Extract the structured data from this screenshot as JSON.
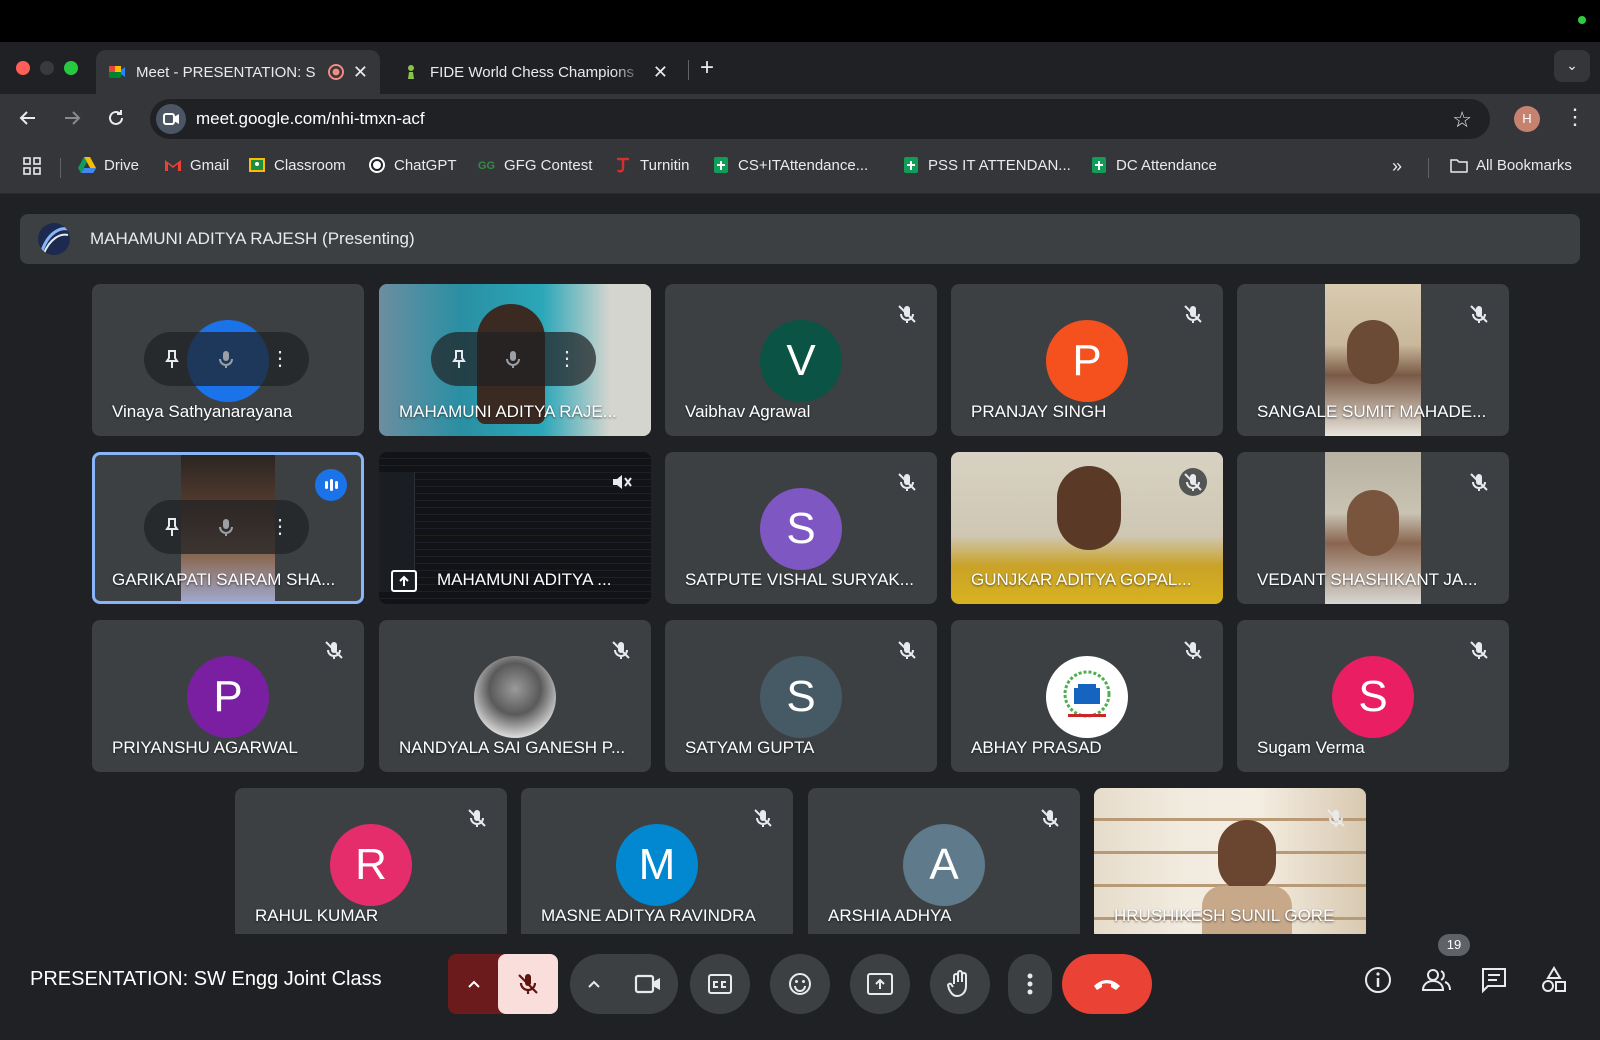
{
  "browser": {
    "tabs": [
      {
        "title": "Meet - PRESENTATION: S",
        "active": true
      },
      {
        "title": "FIDE World Chess Champions",
        "active": false
      }
    ],
    "url": "meet.google.com/nhi-tmxn-acf",
    "profile_initial": "H",
    "bookmarks": [
      {
        "label": "Drive",
        "icon": "drive-icon"
      },
      {
        "label": "Gmail",
        "icon": "gmail-icon"
      },
      {
        "label": "Classroom",
        "icon": "classroom-icon"
      },
      {
        "label": "ChatGPT",
        "icon": "chatgpt-icon"
      },
      {
        "label": "GFG Contest",
        "icon": "gfg-icon"
      },
      {
        "label": "Turnitin",
        "icon": "turnitin-icon"
      },
      {
        "label": "CS+ITAttendance...",
        "icon": "sheets-icon"
      },
      {
        "label": "PSS IT ATTENDAN...",
        "icon": "sheets-icon"
      },
      {
        "label": "DC Attendance",
        "icon": "sheets-icon"
      }
    ],
    "all_bookmarks": "All Bookmarks"
  },
  "meet": {
    "presenting_banner": "MAHAMUNI ADITYA RAJESH (Presenting)",
    "meeting_name": "PRESENTATION: SW Engg Joint Class",
    "participant_count": "19",
    "participants": [
      {
        "name": "Vinaya Sathyanarayana",
        "type": "avatar",
        "initial": "",
        "color": "#1a73e8"
      },
      {
        "name": "MAHAMUNI ADITYA RAJE...",
        "type": "video"
      },
      {
        "name": "Vaibhav Agrawal",
        "type": "avatar",
        "initial": "V",
        "color": "#0b5345"
      },
      {
        "name": "PRANJAY SINGH",
        "type": "avatar",
        "initial": "P",
        "color": "#f4511e"
      },
      {
        "name": "SANGALE SUMIT MAHADE...",
        "type": "video"
      },
      {
        "name": "GARIKAPATI SAIRAM SHA...",
        "type": "video"
      },
      {
        "name": "MAHAMUNI ADITYA ...",
        "type": "screen"
      },
      {
        "name": "SATPUTE VISHAL SURYAK...",
        "type": "avatar",
        "initial": "S",
        "color": "#7e57c2"
      },
      {
        "name": "GUNJKAR ADITYA GOPAL...",
        "type": "video"
      },
      {
        "name": "VEDANT SHASHIKANT JA...",
        "type": "video"
      },
      {
        "name": "PRIYANSHU AGARWAL",
        "type": "avatar",
        "initial": "P",
        "color": "#7b1fa2"
      },
      {
        "name": "NANDYALA SAI GANESH P...",
        "type": "photo"
      },
      {
        "name": "SATYAM GUPTA",
        "type": "avatar",
        "initial": "S",
        "color": "#455a64"
      },
      {
        "name": "ABHAY PRASAD",
        "type": "logo"
      },
      {
        "name": "Sugam Verma",
        "type": "avatar",
        "initial": "S",
        "color": "#e91e63"
      },
      {
        "name": "RAHUL KUMAR",
        "type": "avatar",
        "initial": "R",
        "color": "#e52d6b"
      },
      {
        "name": "MASNE ADITYA RAVINDRA",
        "type": "avatar",
        "initial": "M",
        "color": "#0288d1"
      },
      {
        "name": "ARSHIA ADHYA",
        "type": "avatar",
        "initial": "A",
        "color": "#5f7a8a"
      },
      {
        "name": "HRUSHIKESH SUNIL GORE",
        "type": "video"
      }
    ]
  }
}
